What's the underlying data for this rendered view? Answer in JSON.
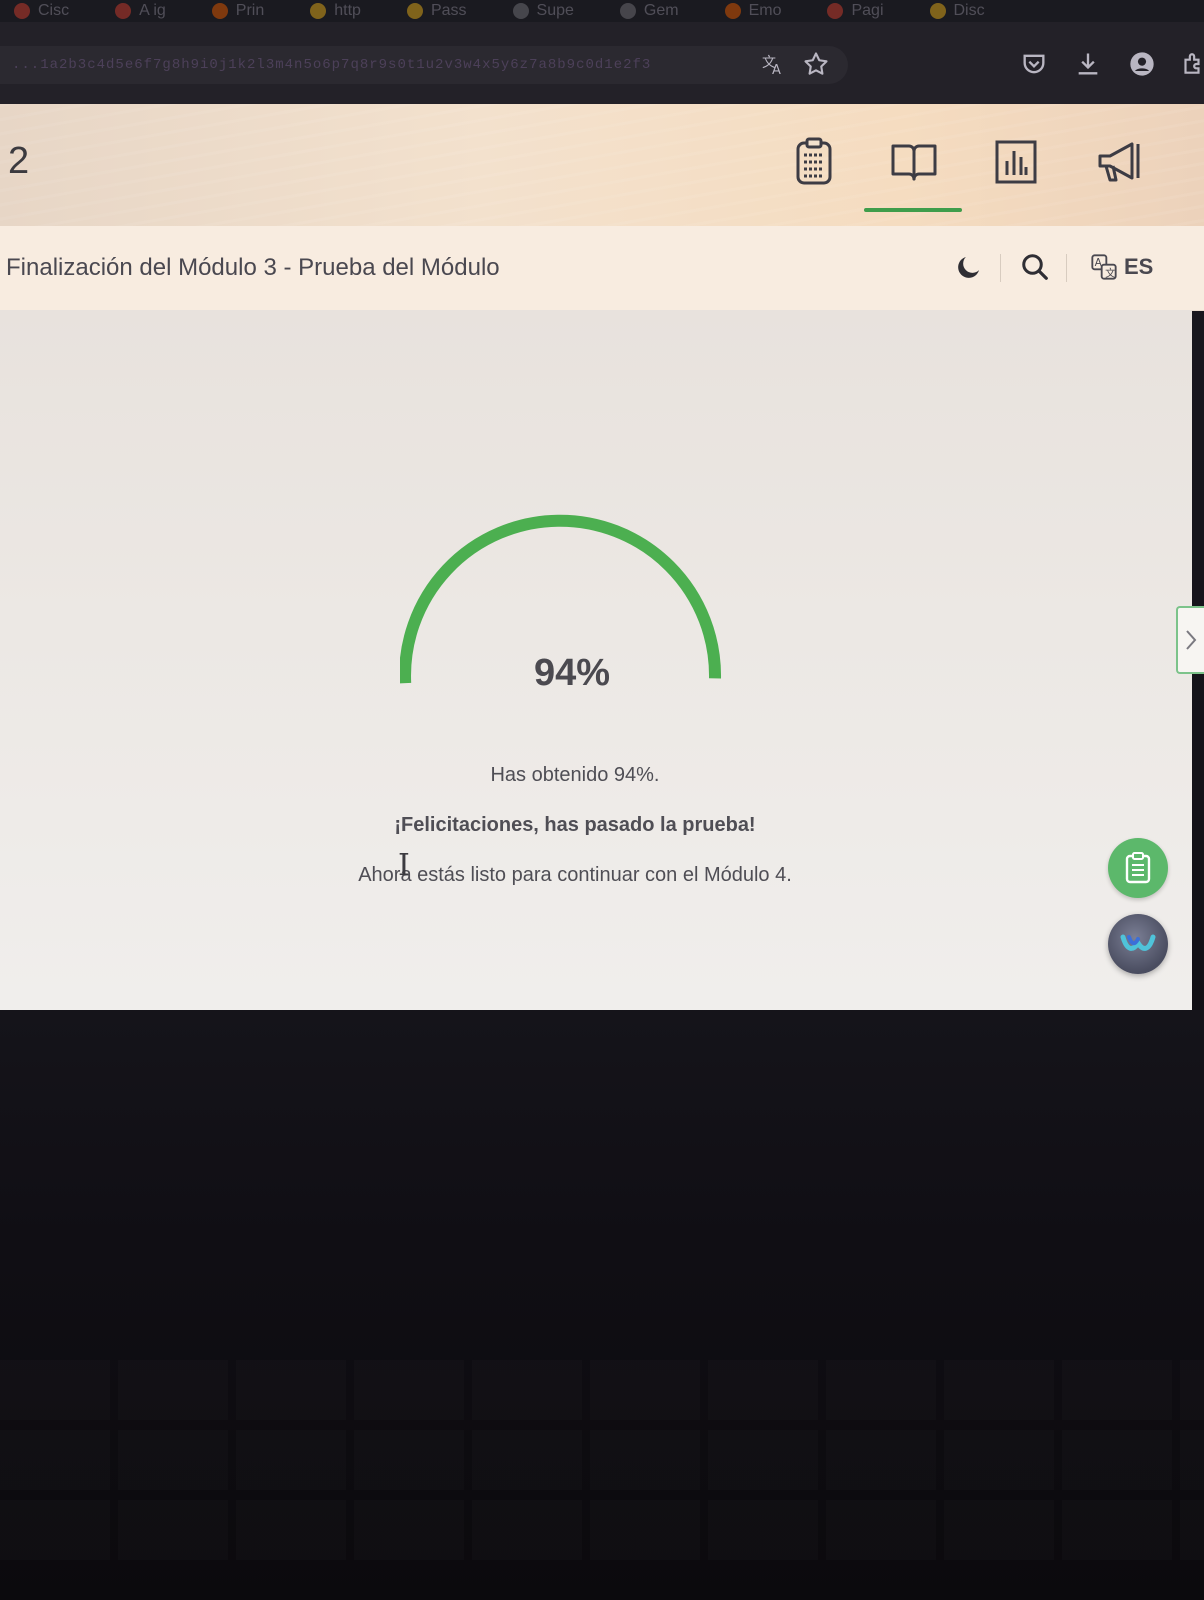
{
  "browser": {
    "bookmarks": [
      "Cisc",
      "A ig",
      "Prin",
      "http",
      "Pass",
      "Supe",
      "Gem",
      "Emo",
      "Pagi",
      "Disc"
    ],
    "url": "...1a2b3c4d5e6f7g8h9i0j1k2l3m4n5o6p7q8r9s0t1u2v3w4x5y6z7a8b9c0d1e2f3",
    "icons": [
      "translate-icon",
      "bookmark-star-icon",
      "pocket-icon",
      "download-icon",
      "account-icon",
      "extensions-icon"
    ]
  },
  "header": {
    "left_number": "2",
    "nav": [
      "clipboard-list-icon",
      "book-open-icon",
      "bar-chart-icon",
      "megaphone-icon"
    ],
    "active_nav_index": 1
  },
  "subheader": {
    "title": "Finalización del Módulo 3 - Prueba del Módulo",
    "language": "ES"
  },
  "result": {
    "percent_label": "94%",
    "percent_value": 94,
    "line1": "Has obtenido 94%.",
    "line2": "¡Felicitaciones, has pasado la prueba!",
    "line3": "Ahora estás listo para continuar con el Módulo 4."
  },
  "colors": {
    "accent_green": "#4caf50",
    "fab_green": "#5cb86b",
    "header_bg": "#f3e1cd"
  }
}
